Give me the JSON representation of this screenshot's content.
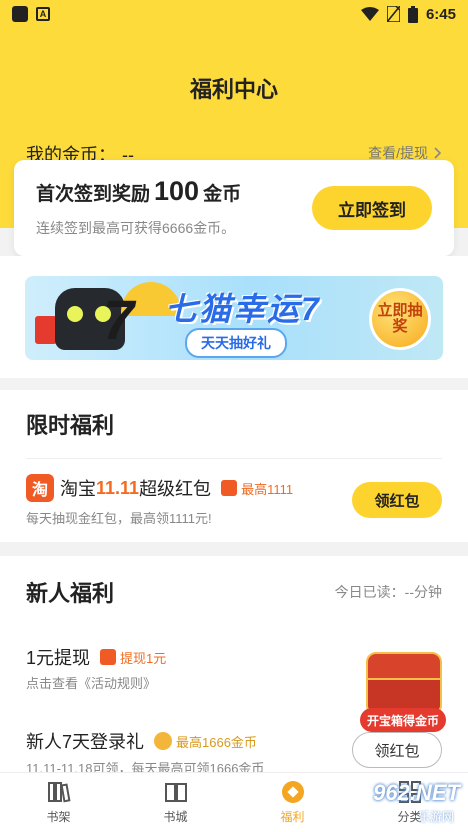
{
  "status_bar": {
    "time": "6:45"
  },
  "header": {
    "title": "福利中心",
    "coins_label": "我的金币：",
    "coins_value": "--",
    "view_link": "查看/提现"
  },
  "signin": {
    "title_prefix": "首次签到奖励",
    "title_amount": "100",
    "title_suffix": "金币",
    "subtitle": "连续签到最高可获得6666金币。",
    "button": "立即签到"
  },
  "banner": {
    "title": "七猫幸运7",
    "pill": "天天抽好礼",
    "cta": "立即抽奖"
  },
  "limited": {
    "section_title": "限时福利",
    "item": {
      "icon_text": "淘",
      "title_prefix": "淘宝",
      "title_highlight": "11.11",
      "title_suffix": "超级红包",
      "badge": "最高1111",
      "subtitle": "每天抽现金红包，最高领1111元!",
      "button": "领红包"
    }
  },
  "newbie": {
    "section_title": "新人福利",
    "read_time": "今日已读：--分钟",
    "items": [
      {
        "title": "1元提现",
        "badge": "提现1元",
        "subtitle": "点击查看《活动规则》"
      },
      {
        "title": "新人7天登录礼",
        "badge": "最高1666金币",
        "subtitle": "11.11-11.18可领，每天最高可领1666金币",
        "button": "领红包"
      }
    ],
    "treasure_label": "开宝箱得金币"
  },
  "tabbar": {
    "tabs": [
      {
        "label": "书架",
        "icon": "bookshelf-icon"
      },
      {
        "label": "书城",
        "icon": "book-icon"
      },
      {
        "label": "福利",
        "icon": "welfare-icon",
        "active": true
      },
      {
        "label": "分类",
        "icon": "category-icon"
      }
    ]
  },
  "watermark": {
    "logo": "962.NET",
    "sub": "乐游网"
  },
  "colors": {
    "accent": "#fddb3a",
    "button": "#fdd32e",
    "highlight": "#f36b1f",
    "active_tab": "#f4a522"
  }
}
